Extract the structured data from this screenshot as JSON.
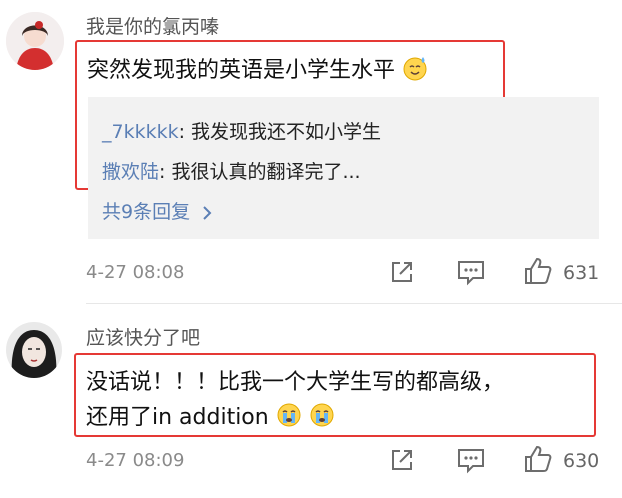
{
  "comments": [
    {
      "username": "我是你的氯丙嗪",
      "text": "突然发现我的英语是小学生水平",
      "replies": [
        {
          "name": "_7kkkkk",
          "text": ": 我发现我还不如小学生"
        },
        {
          "name": "撒欢陆",
          "text": ": 我很认真的翻译完了..."
        }
      ],
      "more_replies": "共9条回复",
      "time": "4-27 08:08",
      "likes": "631"
    },
    {
      "username": "应该快分了吧",
      "text_line1": "没话说！！！比我一个大学生写的都高级，",
      "text_line2": "还用了in addition",
      "time": "4-27 08:09",
      "likes": "630"
    }
  ],
  "icons": {
    "share": "share-icon",
    "comment": "comment-icon",
    "like": "thumbs-up-icon",
    "emoji_sweat": "sweat-smile-emoji",
    "emoji_cry": "crying-emoji"
  },
  "colors": {
    "highlight_frame": "#e53935",
    "link_blue": "#5b7fb5",
    "reply_bg": "#f2f2f2"
  }
}
